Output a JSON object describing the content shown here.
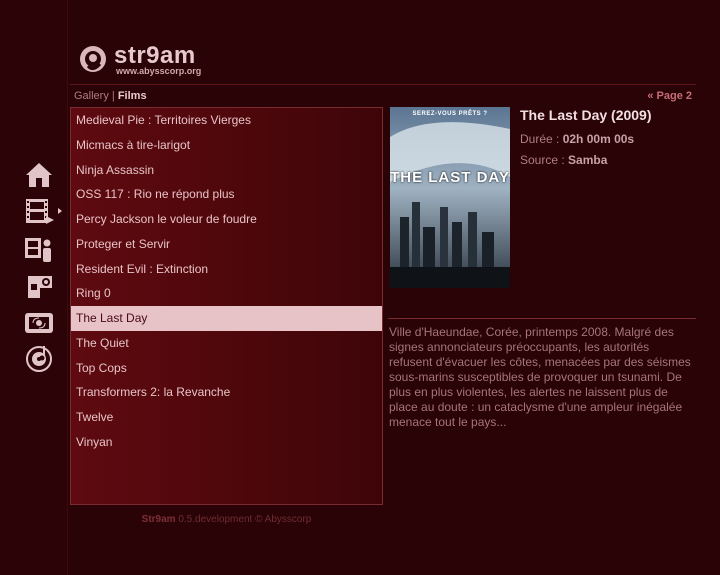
{
  "app": {
    "logo_name": "str9am",
    "logo_url": "www.abysscorp.org"
  },
  "breadcrumb": {
    "parent": "Gallery",
    "separator": "|",
    "current": "Films"
  },
  "pagination": {
    "label": "« Page 2"
  },
  "films": [
    "Medieval Pie : Territoires Vierges",
    "Micmacs à tire-larigot",
    "Ninja Assassin",
    "OSS 117 : Rio ne répond plus",
    "Percy Jackson le voleur de foudre",
    "Proteger et Servir",
    "Resident Evil : Extinction",
    "Ring 0",
    "The Last Day",
    "The Quiet",
    "Top Cops",
    "Transformers 2: la Revanche",
    "Twelve",
    "Vinyan"
  ],
  "selected_index": 8,
  "nav": {
    "icons": [
      "home-icon",
      "film-icon",
      "film-person-icon",
      "camera-icon",
      "tv-icon",
      "music-icon"
    ],
    "active": "film-icon"
  },
  "detail": {
    "title": "The Last Day (2009)",
    "duration_label": "Durée :",
    "duration_value": "02h 00m 00s",
    "source_label": "Source :",
    "source_value": "Samba",
    "poster_tagline": "SEREZ-VOUS PRÊTS ?",
    "poster_title": "THE LAST DAY",
    "description": "Ville d'Haeundae, Corée, printemps 2008. Malgré des signes annonciateurs préoccupants, les autorités refusent d'évacuer les côtes, menacées par des séismes sous-marins susceptibles de provoquer un tsunami. De plus en plus violentes, les alertes ne laissent plus de place au doute : un cataclysme d'une ampleur inégalée menace tout le pays..."
  },
  "footer": {
    "brand": "Str9am",
    "text": "0.5.development © Abysscorp"
  },
  "colors": {
    "background": "#2a0306",
    "list_bg": "#5e0a10",
    "selected_bg": "#e7c3c8",
    "accent": "#c56d76"
  }
}
